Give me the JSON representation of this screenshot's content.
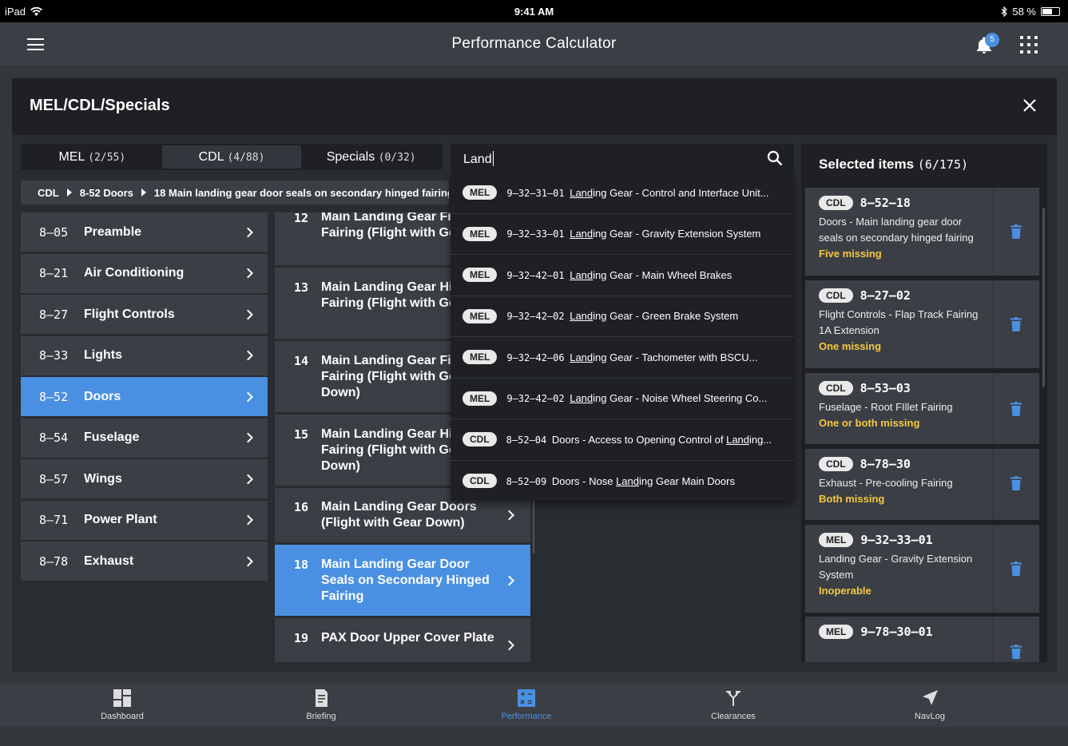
{
  "status_bar": {
    "device": "iPad",
    "time": "9:41 AM",
    "battery_percent": "58 %",
    "battery_level": 0.58
  },
  "header": {
    "title": "Performance Calculator",
    "notification_count": "5"
  },
  "modal": {
    "title": "MEL/CDL/Specials",
    "tabs": [
      {
        "label": "MEL",
        "count": "(2/55)",
        "active": false
      },
      {
        "label": "CDL",
        "count": "(4/88)",
        "active": true
      },
      {
        "label": "Specials",
        "count": "(0/32)",
        "active": false
      }
    ],
    "breadcrumb": [
      "CDL",
      "8-52 Doors",
      "18 Main landing gear door seals on secondary hinged fairing"
    ],
    "search": {
      "value": "Land"
    },
    "chapters": [
      {
        "code": "8–05",
        "label": "Preamble"
      },
      {
        "code": "8–21",
        "label": "Air Conditioning"
      },
      {
        "code": "8–27",
        "label": "Flight Controls"
      },
      {
        "code": "8–33",
        "label": "Lights"
      },
      {
        "code": "8–52",
        "label": "Doors",
        "active": true
      },
      {
        "code": "8–54",
        "label": "Fuselage"
      },
      {
        "code": "8–57",
        "label": "Wings"
      },
      {
        "code": "8–71",
        "label": "Power Plant"
      },
      {
        "code": "8–78",
        "label": "Exhaust"
      }
    ],
    "items": [
      {
        "num": "12",
        "label": "Main Landing Gear Fixed Fairing (Flight with Gear Up)"
      },
      {
        "num": "13",
        "label": "Main Landing Gear Hinged Fairing (Flight with Gear Up)"
      },
      {
        "num": "14",
        "label": "Main Landing Gear Fixed Fairing (Flight with Gear Down)"
      },
      {
        "num": "15",
        "label": "Main Landing Gear Hinged Fairing (Flight with Gear Down)"
      },
      {
        "num": "16",
        "label": "Main Landing Gear Doors (Flight with Gear Down)"
      },
      {
        "num": "18",
        "label": "Main Landing Gear Door Seals on Secondary Hinged Fairing",
        "active": true
      },
      {
        "num": "19",
        "label": "PAX Door Upper Cover Plate"
      }
    ],
    "search_results": [
      {
        "type": "MEL",
        "code": "9–32–31–01",
        "pre": "",
        "match": "Land",
        "post": "ing Gear - Control and Interface Unit..."
      },
      {
        "type": "MEL",
        "code": "9–32–33–01",
        "pre": "",
        "match": "Land",
        "post": "ing Gear - Gravity Extension System"
      },
      {
        "type": "MEL",
        "code": "9–32–42–01",
        "pre": "",
        "match": "Land",
        "post": "ing Gear - Main Wheel Brakes"
      },
      {
        "type": "MEL",
        "code": "9–32–42–02",
        "pre": "",
        "match": "Land",
        "post": "ing Gear - Green Brake System"
      },
      {
        "type": "MEL",
        "code": "9–32–42–06",
        "pre": "",
        "match": "Land",
        "post": "ing Gear - Tachometer with BSCU..."
      },
      {
        "type": "MEL",
        "code": "9–32–42–02",
        "pre": "",
        "match": "Land",
        "post": "ing Gear - Noise Wheel Steering Co..."
      },
      {
        "type": "CDL",
        "code": "8–52–04",
        "pre": "Doors - Access to Opening Control of ",
        "match": "Land",
        "post": "ing..."
      },
      {
        "type": "CDL",
        "code": "8–52–09",
        "pre": "Doors - Nose ",
        "match": "Land",
        "post": "ing Gear Main Doors"
      }
    ],
    "selected": {
      "title": "Selected items",
      "count": "(6/175)",
      "items": [
        {
          "type": "CDL",
          "code": "8–52–18",
          "desc": "Doors - Main landing gear door seals on secondary hinged fairing",
          "status": "Five missing"
        },
        {
          "type": "CDL",
          "code": "8–27–02",
          "desc": "Flight Controls - Flap Track Fairing 1A Extension",
          "status": "One missing"
        },
        {
          "type": "CDL",
          "code": "8–53–03",
          "desc": "Fuselage - Root FIllet Fairing",
          "status": "One or both missing"
        },
        {
          "type": "CDL",
          "code": "8–78–30",
          "desc": "Exhaust - Pre-cooling Fairing",
          "status": "Both missing"
        },
        {
          "type": "MEL",
          "code": "9–32–33–01",
          "desc": "Landing Gear - Gravity Extension System",
          "status": "Inoperable"
        },
        {
          "type": "MEL",
          "code": "9–78–30–01",
          "desc": "",
          "status": ""
        }
      ]
    }
  },
  "tabbar": [
    {
      "label": "Dashboard",
      "icon": "dashboard-icon"
    },
    {
      "label": "Briefing",
      "icon": "briefing-icon"
    },
    {
      "label": "Performance",
      "icon": "calculator-icon",
      "active": true
    },
    {
      "label": "Clearances",
      "icon": "clearances-icon"
    },
    {
      "label": "NavLog",
      "icon": "navigation-arrow-icon"
    }
  ],
  "colors": {
    "accent": "#4a90e2",
    "status_warning": "#f5c842",
    "background": "#34373c"
  }
}
